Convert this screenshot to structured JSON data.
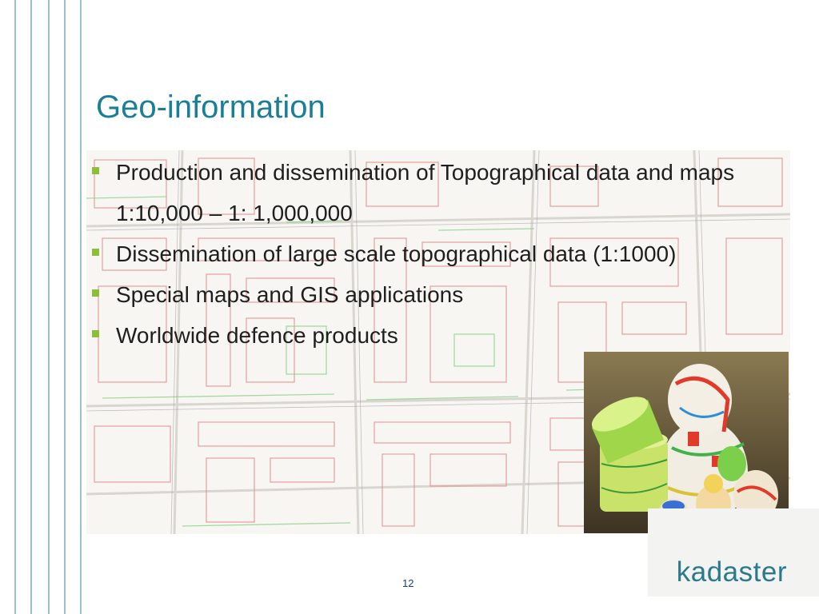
{
  "slide": {
    "title": "Geo-information",
    "bullets": [
      {
        "text": "Production and dissemination of Topographical data and maps 1:10,000 – 1: 1,000,000"
      },
      {
        "text": "Dissemination of large scale topographical data (1:1000)"
      },
      {
        "text": "Special maps and GIS applications"
      },
      {
        "text": "Worldwide defence products"
      }
    ],
    "page_number": "12"
  },
  "logo": {
    "text": "kadaster"
  },
  "colors": {
    "title": "#1a7f96",
    "bullet": "#8bbf3a",
    "logo": "#2a7a8c",
    "map_buildings": "#e58a8a",
    "map_green": "#7fcf7f",
    "side_lines": "#9cc0cc"
  },
  "decor": {
    "background_image": "topographic-map",
    "photo": "nested-matryoshka-dolls-painted-with-maps"
  }
}
